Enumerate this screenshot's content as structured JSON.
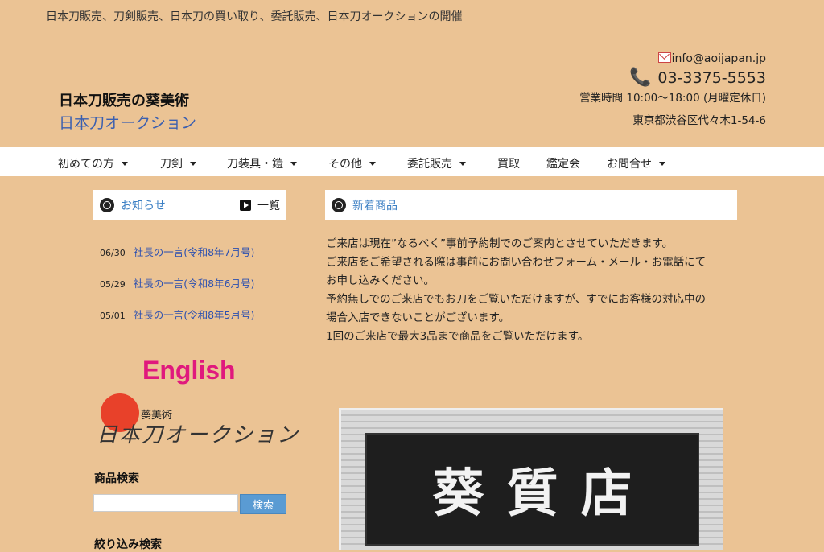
{
  "header": {
    "tagline": "日本刀販売、刀剣販売、日本刀の買い取り、委託販売、日本刀オークションの開催",
    "brand_name": "日本刀販売の葵美術",
    "brand_sub": "日本刀オークション",
    "email": "info@aoijapan.jp",
    "phone": "03-3375-5553",
    "hours": "営業時間 10:00～18:00 (月曜定休日)",
    "address": "東京都渋谷区代々木1-54-6"
  },
  "nav": {
    "items": [
      {
        "label": "初めての方"
      },
      {
        "label": "刀剣"
      },
      {
        "label": "刀装具・鎧"
      },
      {
        "label": "その他"
      },
      {
        "label": "委託販売"
      },
      {
        "label": "買取"
      },
      {
        "label": "鑑定会"
      },
      {
        "label": "お問合せ"
      }
    ]
  },
  "news": {
    "title": "お知らせ",
    "list_label": "一覧",
    "items": [
      {
        "date": "06/30",
        "title": "社長の一言(令和8年7月号)"
      },
      {
        "date": "05/29",
        "title": "社長の一言(令和8年6月号)"
      },
      {
        "date": "05/01",
        "title": "社長の一言(令和8年5月号)"
      }
    ]
  },
  "new_products": {
    "title": "新着商品",
    "notice": [
      "ご来店は現在”なるべく”事前予約制でのご案内とさせていただきます。",
      "ご来店をご希望される際は事前にお問い合わせフォーム・メール・お電話にて",
      "お申し込みください。",
      "予約無しでのご来店でもお刀をご覧いただけますが、すでにお客様の対応中の",
      "場合入店できないことがございます。",
      "1回のご来店で最大3品まで商品をご覧いただけます。"
    ]
  },
  "sidebar": {
    "english_label": "English",
    "logo_small": "葵美術",
    "logo_script": "日本刀オークション",
    "search_title": "商品検索",
    "search_value": "",
    "search_button": "検索",
    "filter_title": "絞り込み検索"
  },
  "photo": {
    "sign_chars": [
      "葵",
      "質",
      "店"
    ]
  }
}
